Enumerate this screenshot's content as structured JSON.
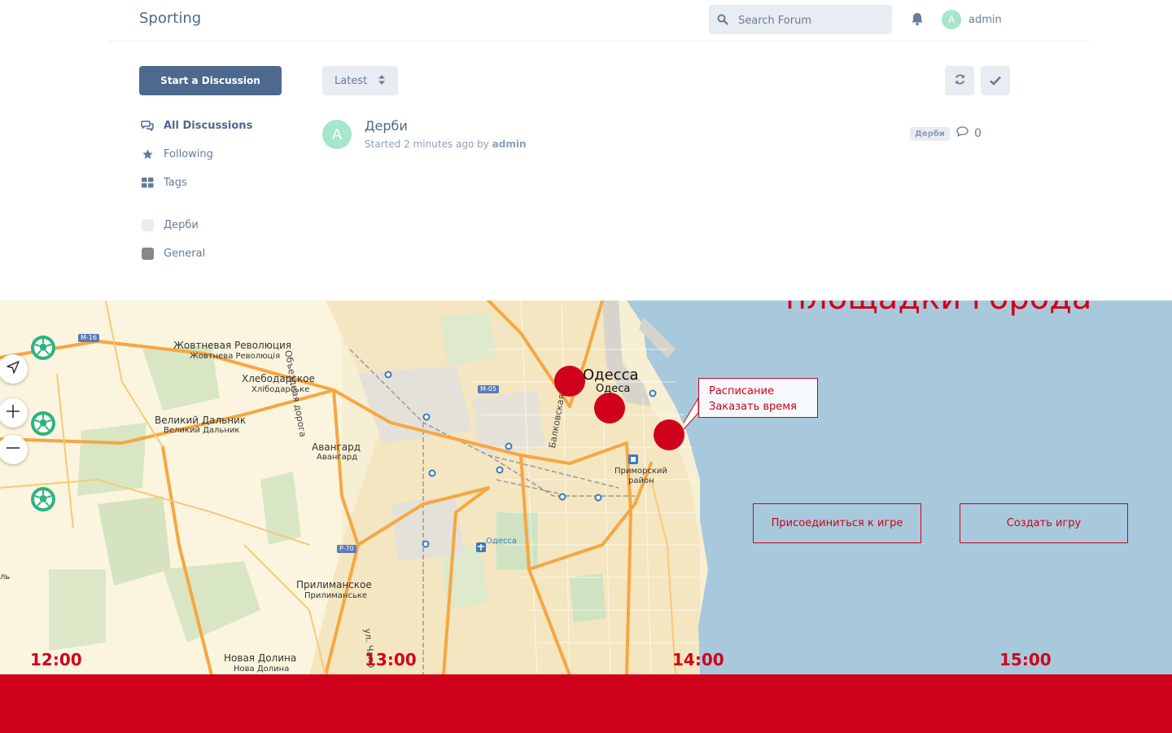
{
  "header": {
    "brand": "Sporting",
    "search": {
      "placeholder": "Search Forum"
    },
    "user": {
      "avatar_letter": "A",
      "name": "admin"
    }
  },
  "sidebar": {
    "start_button": "Start a Discussion",
    "nav": [
      {
        "label": "All Discussions",
        "icon": "comments-icon",
        "active": true
      },
      {
        "label": "Following",
        "icon": "star-icon",
        "active": false
      },
      {
        "label": "Tags",
        "icon": "tags-grid-icon",
        "active": false
      }
    ],
    "tags": [
      {
        "label": "Дерби",
        "color": "#e8ecf3"
      },
      {
        "label": "General",
        "color": "#888888"
      }
    ]
  },
  "toolbar": {
    "sort_label": "Latest",
    "refresh_icon": "refresh-icon",
    "mark_read_icon": "check-icon"
  },
  "discussions": [
    {
      "avatar_letter": "A",
      "title": "Дерби",
      "meta_prefix": "Started 2 minutes ago by",
      "author": "admin",
      "tag": "Дерби",
      "replies": "0"
    }
  ],
  "map_section": {
    "title": "площадки города",
    "popup": {
      "line1": "Расписание",
      "line2": "Заказать время"
    },
    "join_button": "Присоединиться к игре",
    "create_button": "Создать игру",
    "times": [
      "12:00",
      "13:00",
      "14:00",
      "15:00"
    ],
    "places": {
      "zhovtneva": "Жовтневая Революция",
      "zhovtneva_sub": "Жовтнева Революція",
      "khlebodarskoe": "Хлебодарское",
      "khlebodarskoe_sub": "Хлібодарське",
      "dalnik": "Великий Дальник",
      "dalnik_sub": "Великий Дальник",
      "avangard": "Авангард",
      "avangard_sub": "Авангард",
      "odessa": "Одесса",
      "odessa_sub": "Одеса",
      "primorsky": "Приморский",
      "primorsky2": "район",
      "prilimanskoe": "Прилиманское",
      "prilimanskoe_sub": "Прилиманське",
      "nova_dolina": "Новая Долина",
      "nova_dolina_sub": "Нова Долина",
      "airport": "Одесса",
      "road_obezd": "Объездная дорога",
      "road_balkovskaya": "Балковская",
      "road_ul": "ул. Чапо",
      "edge_text": "ль"
    },
    "shields": [
      "M-16",
      "M-05",
      "P-70"
    ],
    "map_colors": {
      "land": "#f6efd4",
      "sea": "#a8c9dc",
      "road": "#f5a742",
      "park": "#cfe2c1"
    }
  },
  "accent_color": "#d0021b"
}
